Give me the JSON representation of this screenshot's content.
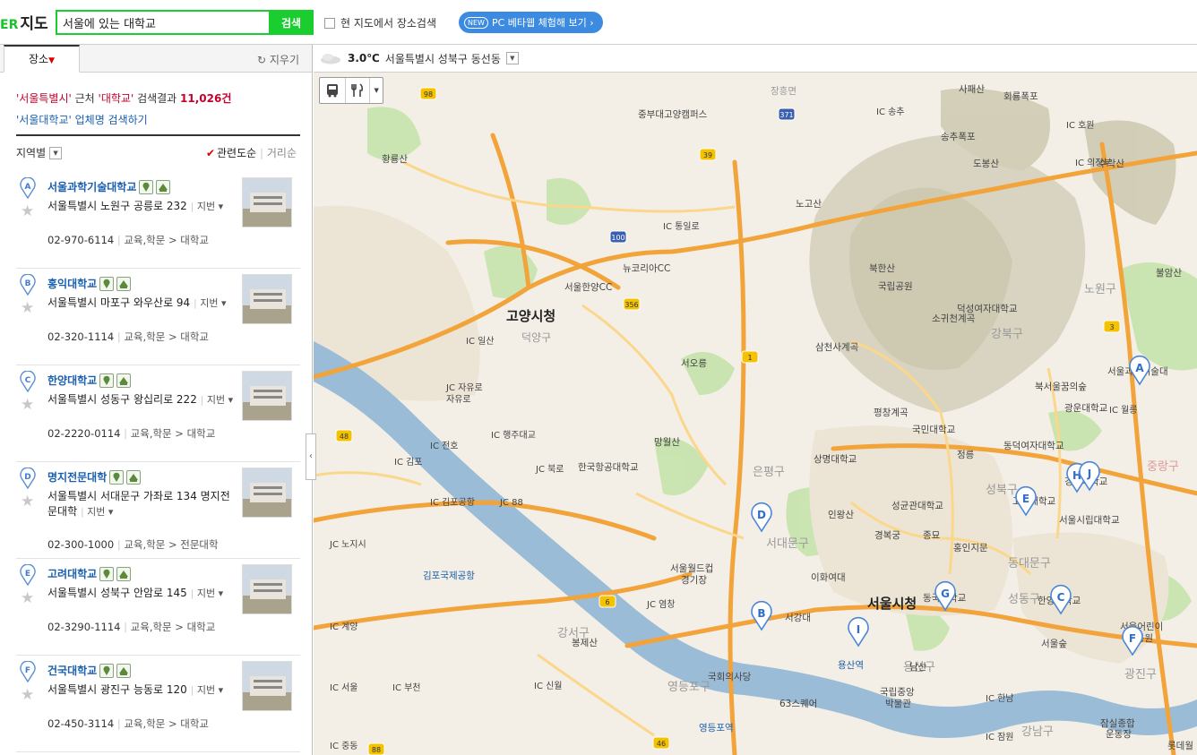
{
  "header": {
    "logo_brand": "ER",
    "logo_title": "지도",
    "search_value": "서울에 있는 대학교",
    "search_button": "검색",
    "current_area_label": "현 지도에서 장소검색",
    "beta_badge": "NEW",
    "beta_label": "PC 베타웹 체험해 보기 ›"
  },
  "panel": {
    "tab_label": "장소",
    "clear_label": "지우기",
    "summary_region": "'서울특별시'",
    "summary_near": " 근처 ",
    "summary_query": "'대학교'",
    "summary_result": " 검색결과 ",
    "summary_count": "11,026건",
    "summary_link_name": "'서울대학교'",
    "summary_link_rest": " 업체명 검색하기",
    "region_filter": "지역별",
    "sort_relevance": "관련도순",
    "sort_distance": "거리순"
  },
  "results": [
    {
      "pin": "A",
      "name": "서울과학기술대학교",
      "addr": "서울특별시 노원구 공릉로 232",
      "jibun": "지번",
      "tel": "02-970-6114",
      "cat": "교육,학문 > 대학교"
    },
    {
      "pin": "B",
      "name": "홍익대학교",
      "addr": "서울특별시 마포구 와우산로 94",
      "jibun": "지번",
      "tel": "02-320-1114",
      "cat": "교육,학문 > 대학교"
    },
    {
      "pin": "C",
      "name": "한양대학교",
      "addr": "서울특별시 성동구 왕십리로 222",
      "jibun": "지번",
      "tel": "02-2220-0114",
      "cat": "교육,학문 > 대학교"
    },
    {
      "pin": "D",
      "name": "명지전문대학",
      "addr": "서울특별시 서대문구 가좌로 134 명지전문대학",
      "jibun": "지번",
      "tel": "02-300-1000",
      "cat": "교육,학문 > 전문대학"
    },
    {
      "pin": "E",
      "name": "고려대학교",
      "addr": "서울특별시 성북구 안암로 145",
      "jibun": "지번",
      "tel": "02-3290-1114",
      "cat": "교육,학문 > 대학교"
    },
    {
      "pin": "F",
      "name": "건국대학교",
      "addr": "서울특별시 광진구 능동로 120",
      "jibun": "지번",
      "tel": "02-450-3114",
      "cat": "교육,학문 > 대학교"
    }
  ],
  "weather": {
    "temp": "3.0℃",
    "location": "서울특별시 성북구 동선동"
  },
  "map": {
    "labels": {
      "goyang": "고양시청",
      "seoul": "서울시청",
      "bukhansan": "북한산",
      "bukhansan_park": "북한산\n국립공원",
      "gimpo_airport": "김포국제공항",
      "noin": "노고산",
      "hwangnyong": "황룡산",
      "gangseo": "강서구",
      "gangbuk": "강북구",
      "nowon": "노원구",
      "eunpyeong": "은평구",
      "seodaemun": "서대문구",
      "seongbuk": "성북구",
      "dongdaemun": "동대문구",
      "seongdong": "성동구",
      "yongsan": "용산구",
      "yeongdeungpo": "영등포구",
      "gangnam": "강남구",
      "gwangjin": "광진구",
      "jungnang": "중랑구",
      "dobong": "도봉산",
      "suraksan": "수락산",
      "buramsan": "불암산",
      "ilsan": "일산",
      "jayuro": "자유로",
      "dodamsan": "덕양구",
      "worldcup": "서울월드컵\n경기장",
      "nambu": "남산",
      "yongsan_stn": "용산역",
      "ydp_stn": "영등포역",
      "assembly": "국회의사당",
      "museum": "국립중앙\n박물관",
      "63": "63스퀘어",
      "bongjesan": "봉제산",
      "ewha": "이화여대",
      "seogang": "서강대",
      "seokyeong": "성균관대학교",
      "korea_univ": "고려대학교",
      "hanyang": "한양대학교",
      "kyunghee": "경희대학교",
      "seoultech": "서울과학기술대",
      "uos": "서울시립대학교",
      "dongguk": "동국대학교",
      "kookmin": "국민대학교",
      "sangmyung": "상명대학교",
      "inwangsan": "인왕산",
      "gyeongbokgung": "경복궁",
      "jongmyo": "종묘",
      "hongji": "홍인지문",
      "dongduk": "동덕여자대학교",
      "duksung": "덕성여자대학교",
      "gwangwoon": "광운대학교",
      "child_park": "서울어린이\n대공원",
      "jamsil": "잠실종합\n운동장",
      "lotte": "롯데월",
      "seooreung": "서오릉",
      "mangwolsan": "망월산",
      "hangong": "한국항공대학교",
      "jungbu": "중부대고양캠퍼스",
      "newkorea": "뉴코리아CC",
      "seoul_hanyang": "서울한양CC",
      "songchu": "송추폭포",
      "sapaesan": "사패산",
      "hoeryong": "회룡폭포",
      "gyeonggi_fort": "장흥면",
      "samcheon": "삼천사계곡",
      "pyeongchang": "평창계곡",
      "socheon": "소귀천계곡",
      "bukseoul": "북서울꿈의숲",
      "jeongneung": "정릉",
      "ic_songchu": "IC 송추",
      "ic_tongil": "IC 통일로",
      "ic_ilsan": "IC 일산",
      "ic_hoho": "IC 호원",
      "ic_uijeongbu": "IC 의정부",
      "ic_wolleung": "IC 월릉",
      "ic_gimpo": "IC 김포",
      "ic_jeonho": "IC 전호",
      "ic_haengju": "IC 행주대교",
      "ic_bungno": "JC 북로",
      "ic_gimpo_airport": "IC 김포공항",
      "jc_88": "JC 88",
      "ic_sinwol": "IC 신월",
      "ic_bucheon": "IC 부천",
      "ic_seoul": "IC 서울",
      "ic_jangdam": "IC 잠원",
      "ic_hannam": "IC 한남",
      "ic_jamwon": "IC 잠원",
      "ic_gyeyang": "IC 계양",
      "ic_nojinsi": "JC 노지시",
      "ic_yeomchang": "JC 염창",
      "ic_jayuro": "JC 자유로",
      "ic_jungdong": "IC 중동",
      "seoul_forest": "서울숲",
      "yongsan_family": "용산구"
    },
    "markers": [
      "A",
      "B",
      "C",
      "D",
      "E",
      "F",
      "G",
      "H",
      "I",
      "J"
    ],
    "route_numbers": [
      "98",
      "39",
      "100",
      "371",
      "356",
      "1",
      "3",
      "48",
      "6",
      "46",
      "88"
    ]
  },
  "colors": {
    "brand": "#19ce2e",
    "accent_blue": "#3d8be0",
    "highlight_red": "#c4002b",
    "link": "#1a5fad",
    "river": "#9bbcd6",
    "road_major": "#f2a33a",
    "road_minor": "#fbd78c",
    "park": "#bfe0a8",
    "land": "#f3efe6"
  }
}
